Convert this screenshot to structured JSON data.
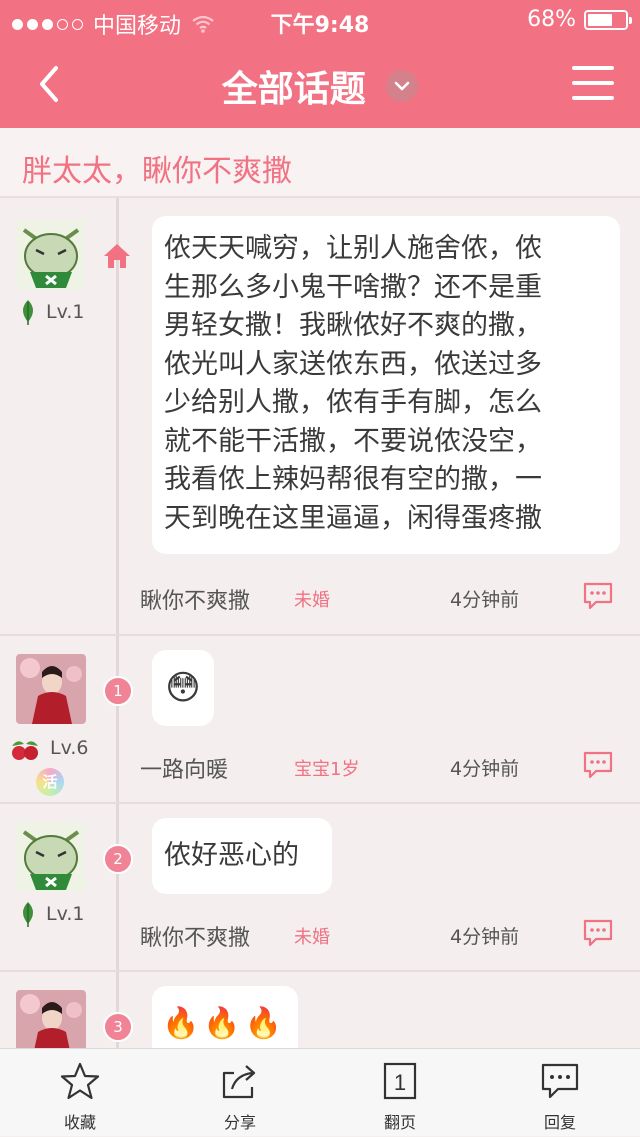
{
  "status_bar": {
    "signal_dots": [
      true,
      true,
      true,
      false,
      false
    ],
    "carrier": "中国移动",
    "time": "下午9:48",
    "battery": "68%",
    "battery_level": 0.68
  },
  "nav": {
    "title": "全部话题"
  },
  "topic": {
    "title": "胖太太，瞅你不爽撒"
  },
  "posts": [
    {
      "level": "Lv.1",
      "text_lines": [
        "侬天天喊穷，让别人施舍侬，侬",
        "生那么多小鬼干啥撒？还不是重",
        "男轻女撒！我瞅侬好不爽的撒，",
        "侬光叫人家送侬东西，侬送过多",
        "少给别人撒，侬有手有脚，怎么",
        "就不能干活撒，不要说侬没空，",
        "我看侬上辣妈帮很有空的撒，一",
        "天到晚在这里逼逼，闲得蛋疼撒"
      ],
      "author": "瞅你不爽撒",
      "status": "未婚",
      "time": "4分钟前"
    },
    {
      "floor": "1",
      "level": "Lv.6",
      "badge": "活",
      "emoji": "😳",
      "author": "一路向暖",
      "status": "宝宝1岁",
      "time": "4分钟前"
    },
    {
      "floor": "2",
      "level": "Lv.1",
      "text": "侬好恶心的",
      "author": "瞅你不爽撒",
      "status": "未婚",
      "time": "4分钟前"
    },
    {
      "floor": "3",
      "emoji": "🔥🔥🔥"
    }
  ],
  "tabbar": {
    "favorite": "收藏",
    "share": "分享",
    "page": "翻页",
    "page_icon_number": "1",
    "reply": "回复"
  },
  "colors": {
    "accent": "#f27183",
    "background": "#f4efee"
  }
}
